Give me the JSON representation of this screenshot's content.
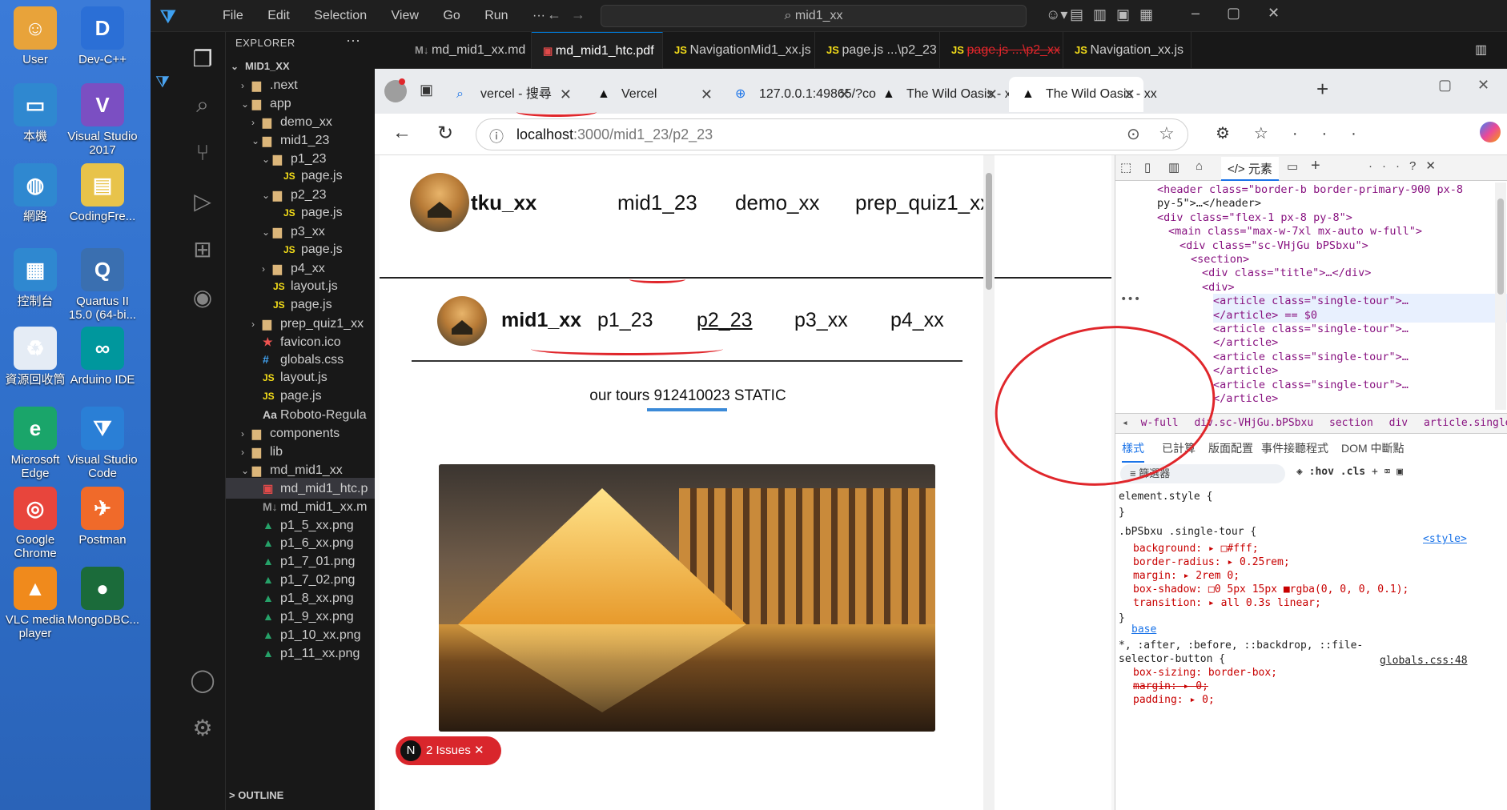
{
  "desktop": {
    "icons": [
      "User",
      "Dev-C++",
      "本機",
      "Visual Studio 2017",
      "網路",
      "CodingFre...",
      "控制台",
      "Quartus II 15.0 (64-bi...",
      "資源回收筒",
      "Arduino IDE",
      "Microsoft Edge",
      "Visual Studio Code",
      "Google Chrome",
      "Postman",
      "VLC media player",
      "MongoDBC..."
    ]
  },
  "vscode": {
    "menu": [
      "File",
      "Edit",
      "Selection",
      "View",
      "Go",
      "Run",
      "···"
    ],
    "search": "mid1_xx",
    "explorer_title": "EXPLORER",
    "tabs": [
      "md_mid1_xx.md",
      "md_mid1_htc.pdf",
      "NavigationMid1_xx.js",
      "page.js ...\\p2_23",
      "page.js ...\\p2_xx",
      "Navigation_xx.js"
    ],
    "tree": [
      {
        "label": "MID1_XX",
        "indent": 0,
        "type": "root",
        "chev": "v"
      },
      {
        "label": ".next",
        "indent": 1,
        "type": "folder",
        "chev": ">"
      },
      {
        "label": "app",
        "indent": 1,
        "type": "folder",
        "chev": "v"
      },
      {
        "label": "demo_xx",
        "indent": 2,
        "type": "folder",
        "chev": ">"
      },
      {
        "label": "mid1_23",
        "indent": 2,
        "type": "folder",
        "chev": "v"
      },
      {
        "label": "p1_23",
        "indent": 3,
        "type": "folder",
        "chev": "v"
      },
      {
        "label": "page.js",
        "indent": 4,
        "type": "js"
      },
      {
        "label": "p2_23",
        "indent": 3,
        "type": "folder",
        "chev": "v"
      },
      {
        "label": "page.js",
        "indent": 4,
        "type": "js"
      },
      {
        "label": "p3_xx",
        "indent": 3,
        "type": "folder",
        "chev": "v"
      },
      {
        "label": "page.js",
        "indent": 4,
        "type": "js"
      },
      {
        "label": "p4_xx",
        "indent": 3,
        "type": "folder",
        "chev": ">"
      },
      {
        "label": "layout.js",
        "indent": 3,
        "type": "js"
      },
      {
        "label": "page.js",
        "indent": 3,
        "type": "js"
      },
      {
        "label": "prep_quiz1_xx",
        "indent": 2,
        "type": "folder",
        "chev": ">"
      },
      {
        "label": "favicon.ico",
        "indent": 2,
        "type": "star"
      },
      {
        "label": "globals.css",
        "indent": 2,
        "type": "css"
      },
      {
        "label": "layout.js",
        "indent": 2,
        "type": "js"
      },
      {
        "label": "page.js",
        "indent": 2,
        "type": "js"
      },
      {
        "label": "Roboto-Regula",
        "indent": 2,
        "type": "font"
      },
      {
        "label": "components",
        "indent": 1,
        "type": "folder",
        "chev": ">"
      },
      {
        "label": "lib",
        "indent": 1,
        "type": "folder",
        "chev": ">"
      },
      {
        "label": "md_mid1_xx",
        "indent": 1,
        "type": "folder",
        "chev": "v"
      },
      {
        "label": "md_mid1_htc.p",
        "indent": 2,
        "type": "pdf",
        "selected": true
      },
      {
        "label": "md_mid1_xx.m",
        "indent": 2,
        "type": "md"
      },
      {
        "label": "p1_5_xx.png",
        "indent": 2,
        "type": "img"
      },
      {
        "label": "p1_6_xx.png",
        "indent": 2,
        "type": "img"
      },
      {
        "label": "p1_7_01.png",
        "indent": 2,
        "type": "img"
      },
      {
        "label": "p1_7_02.png",
        "indent": 2,
        "type": "img"
      },
      {
        "label": "p1_8_xx.png",
        "indent": 2,
        "type": "img"
      },
      {
        "label": "p1_9_xx.png",
        "indent": 2,
        "type": "img"
      },
      {
        "label": "p1_10_xx.png",
        "indent": 2,
        "type": "img"
      },
      {
        "label": "p1_11_xx.png",
        "indent": 2,
        "type": "img"
      }
    ],
    "outline": "OUTLINE"
  },
  "browser": {
    "tabs": [
      "vercel - 搜尋",
      "Vercel",
      "127.0.0.1:49865/?co",
      "The Wild Oasis - xx",
      "The Wild Oasis - xx"
    ],
    "url_host": "localhost",
    "url_path": ":3000/mid1_23/p2_23"
  },
  "page": {
    "brand": "tku_xx",
    "nav": [
      "mid1_23",
      "demo_xx",
      "prep_quiz1_xx"
    ],
    "brand2": "mid1_xx",
    "subnav": [
      "p1_23",
      "p2_23",
      "p3_xx",
      "p4_xx"
    ],
    "heading": "our tours 912410023 STATIC",
    "issues": "2 Issues",
    "issues_badge": "N"
  },
  "devtools": {
    "panel_tab": "元素",
    "dom": [
      {
        "i": 0,
        "t": "<header class=\"border-b border-primary-900 px-8"
      },
      {
        "i": 0,
        "t": "py-5\">…</header>"
      },
      {
        "i": 0,
        "t": "<div class=\"flex-1 px-8 py-8\">"
      },
      {
        "i": 1,
        "t": "<main class=\"max-w-7xl mx-auto w-full\">"
      },
      {
        "i": 2,
        "t": "<div class=\"sc-VHjGu bPSbxu\">"
      },
      {
        "i": 3,
        "t": "<section>"
      },
      {
        "i": 4,
        "t": "<div class=\"title\">…</div>"
      },
      {
        "i": 4,
        "t": "<div>"
      },
      {
        "i": 5,
        "t": "<article class=\"single-tour\">…"
      },
      {
        "i": 5,
        "t": "</article> == $0"
      },
      {
        "i": 5,
        "t": "<article class=\"single-tour\">…"
      },
      {
        "i": 5,
        "t": "</article>"
      },
      {
        "i": 5,
        "t": "<article class=\"single-tour\">…"
      },
      {
        "i": 5,
        "t": "</article>"
      },
      {
        "i": 5,
        "t": "<article class=\"single-tour\">…"
      },
      {
        "i": 5,
        "t": "</article>"
      }
    ],
    "breadcrumb": [
      "w-full",
      "div.sc-VHjGu.bPSbxu",
      "section",
      "div",
      "article.single-tour"
    ],
    "style_tabs": [
      "樣式",
      "已計算",
      "版面配置",
      "事件接聽程式",
      "DOM 中斷點"
    ],
    "filter": "篩選器",
    "hov": ":hov",
    "cls": ".cls",
    "rules": [
      "element.style {",
      "}",
      ".bPSbxu .single-tour {",
      "background: ▸ □#fff;",
      "border-radius: ▸ 0.25rem;",
      "margin: ▸ 2rem 0;",
      "box-shadow: □0 5px 15px ■rgba(0, 0, 0, 0.1);",
      "transition: ▸ all 0.3s linear;",
      "}",
      "base",
      "*, :after, :before, ::backdrop, ::file-",
      "selector-button {",
      "box-sizing: border-box;",
      "margin: ▸ 0;",
      "padding: ▸ 0;"
    ],
    "source_style": "<style>",
    "source_globals": "globals.css:48"
  }
}
